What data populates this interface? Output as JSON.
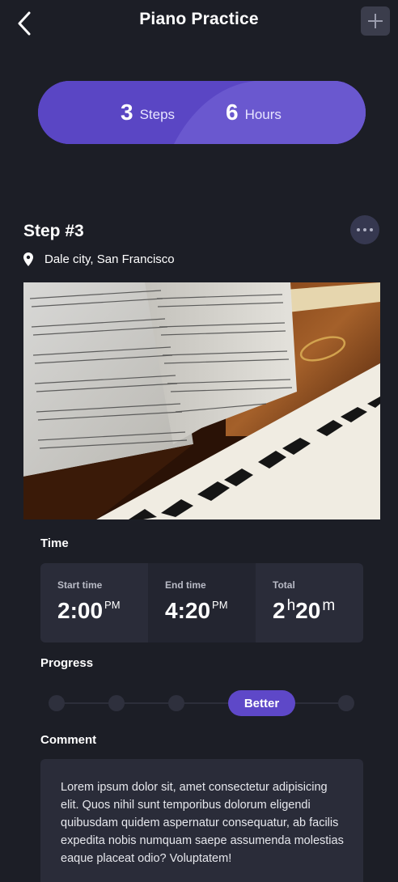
{
  "header": {
    "title": "Piano Practice",
    "back_icon": "chevron-left-icon",
    "add_icon": "plus-icon"
  },
  "summary": {
    "steps_count": "3",
    "steps_label": "Steps",
    "hours_count": "6",
    "hours_label": "Hours",
    "accent": "#5c4ac6"
  },
  "step": {
    "title": "Step #3",
    "location": "Dale city, San Francisco",
    "more_icon": "more-horizontal-icon",
    "photo_alt": "piano-sheet-music-photo"
  },
  "time": {
    "label": "Time",
    "start_caption": "Start time",
    "start_value": "2:00",
    "start_suffix": "PM",
    "end_caption": "End time",
    "end_value": "4:20",
    "end_suffix": "PM",
    "total_caption": "Total",
    "total_hours": "2",
    "total_hours_unit": "h",
    "total_minutes": "20",
    "total_minutes_unit": "m"
  },
  "progress": {
    "label": "Progress",
    "current": "Better",
    "steps_total": 5,
    "current_index": 3
  },
  "comment": {
    "label": "Comment",
    "text": "Lorem ipsum dolor sit, amet consectetur adipisicing elit. Quos nihil sunt temporibus dolorum eligendi quibusdam quidem aspernatur consequatur, ab facilis expedita nobis numquam saepe assumenda molestias eaque placeat odio? Voluptatem!"
  }
}
